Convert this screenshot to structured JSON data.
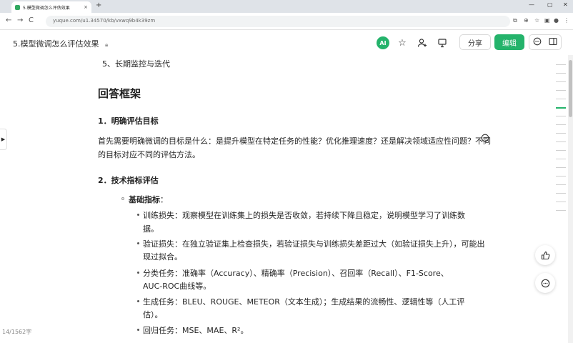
{
  "browser": {
    "tab_title": "5.模型微调怎么评估效果",
    "tab_close": "×",
    "new_tab": "+",
    "url": "yuque.com/u1.34570/kb/vxwq9b4k39zm",
    "nav": {
      "back": "←",
      "forward": "→",
      "reload": "C",
      "home": "⌂"
    }
  },
  "header": {
    "doc_title": "5.模型微调怎么评估效果",
    "ai_label": "AI",
    "share_label": "分享",
    "edit_label": "编辑"
  },
  "content": {
    "top_item": "5、长期监控与迭代",
    "section_title": "回答框架",
    "h1": "1．明确评估目标",
    "p1_line1": "首先需要明确微调的目标是什么：是提升模型在特定任务的性能？优化推理速度？还是解决领域适应性问题？不同",
    "p1_line2": "的目标对应不同的评估方法。",
    "h2": "2．技术指标评估",
    "basic_label": "基础指标：",
    "bold_part": "基础指标",
    "colon": "：",
    "items": [
      {
        "line1": "训练损失：观察模型在训练集上的损失是否收敛，若持续下降且稳定，说明模型学习了训练数",
        "line2": "据。"
      },
      {
        "line1": "验证损失：在独立验证集上检查损失，若验证损失与训练损失差距过大（如验证损失上升），可能出",
        "line2": "现过拟合。"
      },
      {
        "line1": "分类任务：准确率（Accuracy）、精确率（Precision）、召回率（Recall）、F1-Score、",
        "line2": "AUC-ROC曲线等。"
      },
      {
        "line1": "生成任务：BLEU、ROUGE、METEOR（文本生成）；生成结果的流畅性、逻辑性等（人工评",
        "line2": "估）。"
      },
      {
        "line1": "回归任务：MSE、MAE、R²。",
        "line2": ""
      }
    ]
  },
  "status": {
    "word_count": "14/1562字"
  },
  "colors": {
    "accent": "#24b36b"
  }
}
